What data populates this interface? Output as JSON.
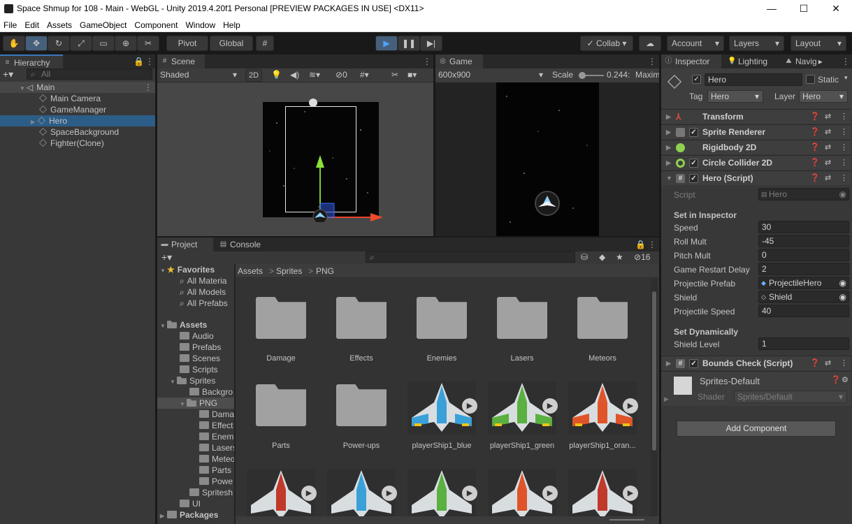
{
  "window": {
    "title": "Space Shmup for 108 - Main - WebGL - Unity 2019.4.20f1 Personal [PREVIEW PACKAGES IN USE] <DX11>"
  },
  "menu": [
    "File",
    "Edit",
    "Assets",
    "GameObject",
    "Component",
    "Window",
    "Help"
  ],
  "toolbar": {
    "pivot": "Pivot",
    "global": "Global",
    "collab": "Collab",
    "account": "Account",
    "layers": "Layers",
    "layout": "Layout"
  },
  "hierarchy": {
    "tab": "Hierarchy",
    "search_placeholder": "All",
    "scene": "Main",
    "items": [
      "Main Camera",
      "GameManager",
      "Hero",
      "SpaceBackground",
      "Fighter(Clone)"
    ],
    "selected": "Hero"
  },
  "scene_view": {
    "tab": "Scene",
    "shading": "Shaded",
    "mode_2d": "2D",
    "hidden_count": "0"
  },
  "game_view": {
    "tab": "Game",
    "resolution": "600x900",
    "scale_label": "Scale",
    "scale_value": "0.244:",
    "maximize": "Maxim"
  },
  "inspector": {
    "tabs": [
      "Inspector",
      "Lighting",
      "Navig"
    ],
    "object_name": "Hero",
    "static_label": "Static",
    "tag_label": "Tag",
    "tag_value": "Hero",
    "layer_label": "Layer",
    "layer_value": "Hero",
    "components": [
      "Transform",
      "Sprite Renderer",
      "Rigidbody 2D",
      "Circle Collider 2D",
      "Hero (Script)"
    ],
    "script_label": "Script",
    "script_value": "Hero",
    "section_inspector": "Set in Inspector",
    "fields": [
      {
        "label": "Speed",
        "value": "30"
      },
      {
        "label": "Roll Mult",
        "value": "-45"
      },
      {
        "label": "Pitch Mult",
        "value": "0"
      },
      {
        "label": "Game Restart Delay",
        "value": "2"
      },
      {
        "label": "Projectile Prefab",
        "value": "ProjectileHero"
      },
      {
        "label": "Shield",
        "value": "Shield"
      },
      {
        "label": "Projectile Speed",
        "value": "40"
      }
    ],
    "section_dynamic": "Set Dynamically",
    "shield_level_label": "Shield Level",
    "shield_level_value": "1",
    "bounds_check": "Bounds Check (Script)",
    "material_name": "Sprites-Default",
    "shader_label": "Shader",
    "shader_value": "Sprites/Default",
    "add_component": "Add Component"
  },
  "project": {
    "tabs": [
      "Project",
      "Console"
    ],
    "hidden_count": "16",
    "favorites_label": "Favorites",
    "favorites": [
      "All Materia",
      "All Models",
      "All Prefabs"
    ],
    "assets_label": "Assets",
    "tree": [
      "Audio",
      "Prefabs",
      "Scenes",
      "Scripts",
      "Sprites",
      "Backgro",
      "PNG",
      "Dama",
      "Effect",
      "Enemi",
      "Lasers",
      "Meteo",
      "Parts",
      "Powe",
      "Spritesh",
      "UI"
    ],
    "packages_label": "Packages",
    "breadcrumb": [
      "Assets",
      "Sprites",
      "PNG"
    ],
    "grid": [
      "Damage",
      "Effects",
      "Enemies",
      "Lasers",
      "Meteors",
      "Parts",
      "Power-ups",
      "playerShip1_blue",
      "playerShip1_green",
      "playerShip1_oran..."
    ]
  },
  "colors": {
    "accent": "#2c5d87",
    "play": "#46607c",
    "ship_blue": "#3aa0d8",
    "ship_green": "#5ab040",
    "ship_orange": "#e0542a",
    "ship_red": "#c0392b"
  }
}
